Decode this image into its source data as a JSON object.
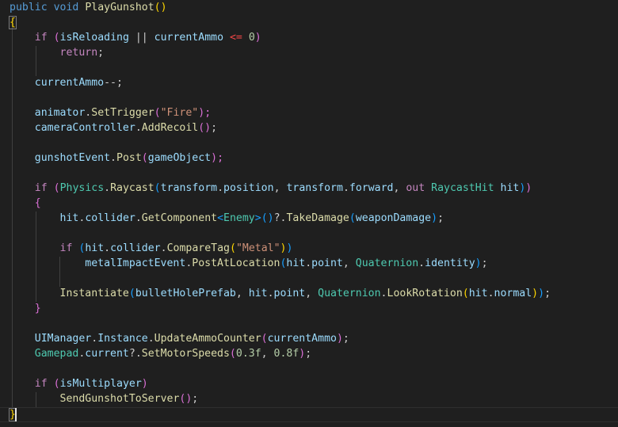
{
  "editor": {
    "language": "csharp",
    "theme": {
      "background": "#1f1f1f",
      "keyword": "#569cd6",
      "control": "#c586c0",
      "function": "#dcdcaa",
      "identifier": "#9cdcfe",
      "type": "#4ec9b0",
      "string": "#ce9178",
      "number": "#b5cea8",
      "bracket_1": "#ffd700",
      "bracket_2": "#da70d6",
      "bracket_3": "#179fff"
    },
    "code": {
      "l1": {
        "t1": "public",
        "t2": " ",
        "t3": "void",
        "t4": " ",
        "t5": "PlayGunshot",
        "t6": "()"
      },
      "l2": {
        "t1": "{"
      },
      "l3": {
        "t1": "    ",
        "t2": "if",
        "t3": " ",
        "t4": "(",
        "t5": "isReloading",
        "t6": " || ",
        "t7": "currentAmmo",
        "t8": " ",
        "t9": "<=",
        "t10": " ",
        "t11": "0",
        "t12": ")"
      },
      "l4": {
        "t1": "        ",
        "t2": "return",
        "t3": ";"
      },
      "l6": {
        "t1": "    ",
        "t2": "currentAmmo",
        "t3": "--;"
      },
      "l8": {
        "t1": "    ",
        "t2": "animator",
        "t3": ".",
        "t4": "SetTrigger",
        "t5": "(",
        "t6": "\"Fire\"",
        "t7": ");"
      },
      "l9": {
        "t1": "    ",
        "t2": "cameraController",
        "t3": ".",
        "t4": "AddRecoil",
        "t5": "()",
        "t6": ";"
      },
      "l11": {
        "t1": "    ",
        "t2": "gunshotEvent",
        "t3": ".",
        "t4": "Post",
        "t5": "(",
        "t6": "gameObject",
        "t7": ");"
      },
      "l13": {
        "t1": "    ",
        "t2": "if",
        "t3": " ",
        "t4": "(",
        "t5": "Physics",
        "t6": ".",
        "t7": "Raycast",
        "t8": "(",
        "t9": "transform",
        "t10": ".",
        "t11": "position",
        "t12": ", ",
        "t13": "transform",
        "t14": ".",
        "t15": "forward",
        "t16": ", ",
        "t17": "out",
        "t18": " ",
        "t19": "RaycastHit",
        "t20": " ",
        "t21": "hit",
        "t22": ")",
        "t23": ")"
      },
      "l14": {
        "t1": "    ",
        "t2": "{"
      },
      "l15": {
        "t1": "        ",
        "t2": "hit",
        "t3": ".",
        "t4": "collider",
        "t5": ".",
        "t6": "GetComponent",
        "t7": "<",
        "t8": "Enemy",
        "t9": ">",
        "t10": "()",
        "t11": "?.",
        "t12": "TakeDamage",
        "t13": "(",
        "t14": "weaponDamage",
        "t15": ")",
        "t16": ";"
      },
      "l17": {
        "t1": "        ",
        "t2": "if",
        "t3": " ",
        "t4": "(",
        "t5": "hit",
        "t6": ".",
        "t7": "collider",
        "t8": ".",
        "t9": "CompareTag",
        "t10": "(",
        "t11": "\"Metal\"",
        "t12": ")",
        "t13": ")"
      },
      "l18": {
        "t1": "            ",
        "t2": "metalImpactEvent",
        "t3": ".",
        "t4": "PostAtLocation",
        "t5": "(",
        "t6": "hit",
        "t7": ".",
        "t8": "point",
        "t9": ", ",
        "t10": "Quaternion",
        "t11": ".",
        "t12": "identity",
        "t13": ")",
        "t14": ";"
      },
      "l20": {
        "t1": "        ",
        "t2": "Instantiate",
        "t3": "(",
        "t4": "bulletHolePrefab",
        "t5": ", ",
        "t6": "hit",
        "t7": ".",
        "t8": "point",
        "t9": ", ",
        "t10": "Quaternion",
        "t11": ".",
        "t12": "LookRotation",
        "t13": "(",
        "t14": "hit",
        "t15": ".",
        "t16": "normal",
        "t17": ")",
        "t18": ")",
        "t19": ";"
      },
      "l21": {
        "t1": "    ",
        "t2": "}"
      },
      "l23": {
        "t1": "    ",
        "t2": "UIManager",
        "t3": ".",
        "t4": "Instance",
        "t5": ".",
        "t6": "UpdateAmmoCounter",
        "t7": "(",
        "t8": "currentAmmo",
        "t9": ")",
        "t10": ";"
      },
      "l24": {
        "t1": "    ",
        "t2": "Gamepad",
        "t3": ".",
        "t4": "current",
        "t5": "?.",
        "t6": "SetMotorSpeeds",
        "t7": "(",
        "t8": "0.3f",
        "t9": ", ",
        "t10": "0.8f",
        "t11": ")",
        "t12": ";"
      },
      "l26": {
        "t1": "    ",
        "t2": "if",
        "t3": " ",
        "t4": "(",
        "t5": "isMultiplayer",
        "t6": ")"
      },
      "l27": {
        "t1": "        ",
        "t2": "SendGunshotToServer",
        "t3": "()",
        "t4": ";"
      },
      "l28": {
        "t1": "}"
      }
    }
  }
}
